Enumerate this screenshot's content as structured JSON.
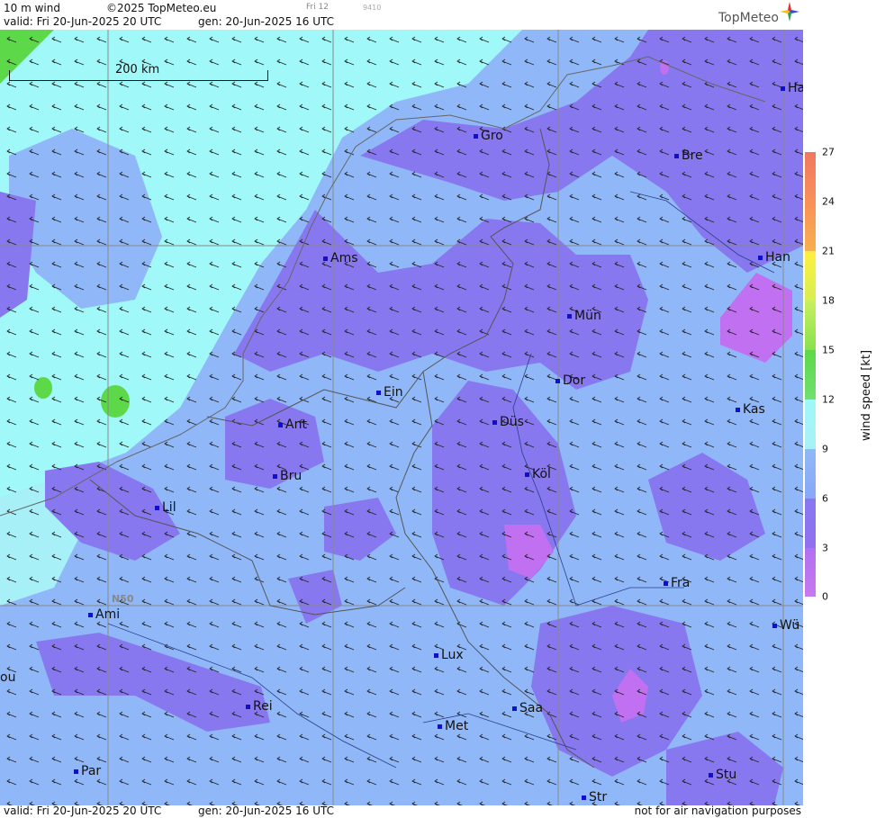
{
  "header": {
    "title": "10 m wind",
    "copyright": "©2025 TopMeteo.eu",
    "run_label": "Fri 12",
    "code": "9410",
    "valid": "valid:  Fri  20-Jun-2025  20 UTC",
    "generated": "gen: 20-Jun-2025 16 UTC",
    "logo": "TopMeteo"
  },
  "footer": {
    "valid": "valid:  Fri  20-Jun-2025  20 UTC",
    "generated": "gen: 20-Jun-2025 16 UTC",
    "disclaimer": "not for air navigation purposes"
  },
  "map": {
    "scale_label": "200 km",
    "grid_label": "N50",
    "cities": [
      {
        "label": "Ha"
      },
      {
        "label": "Gro"
      },
      {
        "label": "Bre"
      },
      {
        "label": "Ams"
      },
      {
        "label": "Han"
      },
      {
        "label": "Mün"
      },
      {
        "label": "Ein"
      },
      {
        "label": "Dor"
      },
      {
        "label": "Kas"
      },
      {
        "label": "Ant"
      },
      {
        "label": "Düs"
      },
      {
        "label": "Bru"
      },
      {
        "label": "Köl"
      },
      {
        "label": "Lil"
      },
      {
        "label": "Fra"
      },
      {
        "label": "Ami"
      },
      {
        "label": "Wü"
      },
      {
        "label": "ou"
      },
      {
        "label": "Lux"
      },
      {
        "label": "Rei"
      },
      {
        "label": "Saa"
      },
      {
        "label": "Met"
      },
      {
        "label": "Par"
      },
      {
        "label": "Stu"
      },
      {
        "label": "Str"
      }
    ]
  },
  "legend": {
    "label": "wind  speed  [kt]",
    "ticks": [
      "27",
      "24",
      "21",
      "18",
      "15",
      "12",
      "9",
      "6",
      "3",
      "0"
    ],
    "colors": [
      "#f07860",
      "#f8a050",
      "#ffe040",
      "#d8ee50",
      "#5cd848",
      "#a0f8f8",
      "#90b8f8",
      "#8878f0",
      "#b070f0",
      "#c878f0"
    ]
  }
}
